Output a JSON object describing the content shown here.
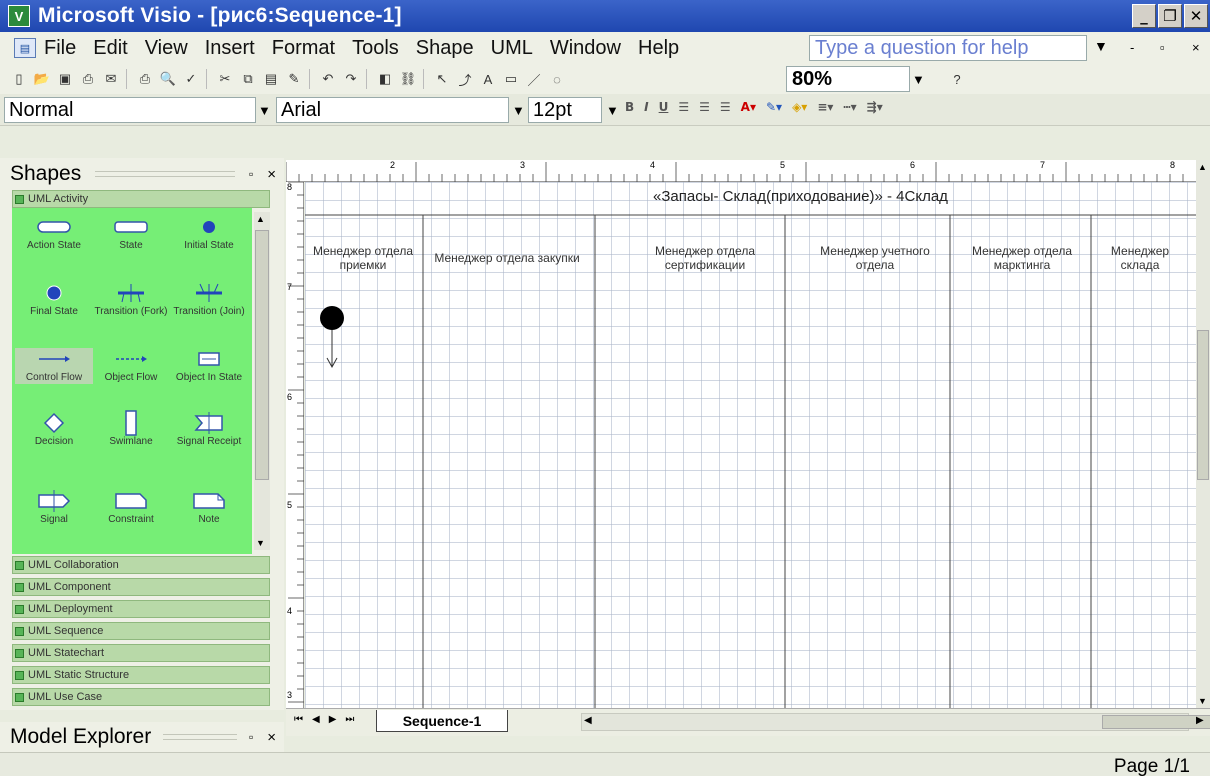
{
  "window": {
    "title": "Microsoft Visio - [рис6:Sequence-1]",
    "app_icon": "visio-icon"
  },
  "menu": {
    "items": [
      "File",
      "Edit",
      "View",
      "Insert",
      "Format",
      "Tools",
      "Shape",
      "UML",
      "Window",
      "Help"
    ],
    "help_placeholder": "Type a question for help"
  },
  "toolbar": {
    "zoom": "80%"
  },
  "formatting": {
    "style": "Normal",
    "font": "Arial",
    "size": "12pt"
  },
  "shapes_panel": {
    "title": "Shapes",
    "active_stencil": "UML Activity",
    "shapes": [
      {
        "label": "Action State",
        "icon": "action-state-icon"
      },
      {
        "label": "State",
        "icon": "state-icon"
      },
      {
        "label": "Initial State",
        "icon": "initial-state-icon"
      },
      {
        "label": "Final State",
        "icon": "final-state-icon"
      },
      {
        "label": "Transition (Fork)",
        "icon": "transition-fork-icon"
      },
      {
        "label": "Transition (Join)",
        "icon": "transition-join-icon"
      },
      {
        "label": "Control Flow",
        "icon": "control-flow-icon"
      },
      {
        "label": "Object Flow",
        "icon": "object-flow-icon"
      },
      {
        "label": "Object In State",
        "icon": "object-in-state-icon"
      },
      {
        "label": "Decision",
        "icon": "decision-icon"
      },
      {
        "label": "Swimlane",
        "icon": "swimlane-icon"
      },
      {
        "label": "Signal Receipt",
        "icon": "signal-receipt-icon"
      },
      {
        "label": "Signal",
        "icon": "signal-icon"
      },
      {
        "label": "Constraint",
        "icon": "constraint-icon"
      },
      {
        "label": "Note",
        "icon": "note-icon"
      }
    ],
    "stencils": [
      "UML Collaboration",
      "UML Component",
      "UML Deployment",
      "UML Sequence",
      "UML Statechart",
      "UML Static Structure",
      "UML Use Case"
    ]
  },
  "model_explorer": {
    "title": "Model Explorer"
  },
  "ruler": {
    "top_labels": [
      "2",
      "3",
      "4",
      "5",
      "6",
      "7",
      "8"
    ],
    "left_labels": [
      "8",
      "7",
      "6",
      "5",
      "4",
      "3"
    ]
  },
  "diagram": {
    "title": "«Запасы- Склад(приходование)» - 4Склад",
    "lanes": [
      "Менеджер отдела приемки",
      "Менеджер отдела закупки",
      "Менеджер отдела сертификации",
      "Менеджер учетного отдела",
      "Менеджер отдела марктинга",
      "Менеджер склада"
    ]
  },
  "tabs": {
    "active": "Sequence-1"
  },
  "status": {
    "page": "Page 1/1"
  }
}
